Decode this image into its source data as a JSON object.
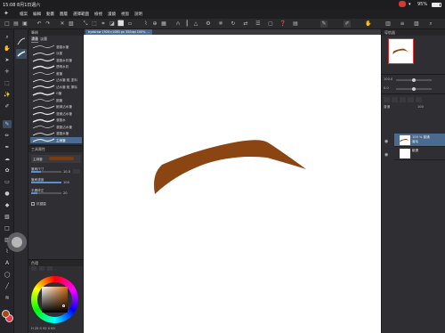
{
  "status": {
    "time": "15:08",
    "date": "8月1日週六",
    "battery": "95%"
  },
  "menu": {
    "items": [
      "檔案",
      "編輯",
      "動畫",
      "圖層",
      "選擇範圍",
      "檢視",
      "濾鏡",
      "視窗",
      "說明"
    ]
  },
  "document": {
    "tab_title": "eyebrow 1920×1080 px 350dpi 100% ..."
  },
  "brush_panel": {
    "title": "筆刷",
    "tabs": [
      "濃墨",
      "淡墨"
    ],
    "brushes": [
      {
        "label": "濃墨水筆"
      },
      {
        "label": "淡墨"
      },
      {
        "label": "濃墨水彩筆"
      },
      {
        "label": "透明水彩"
      },
      {
        "label": "畫筆"
      },
      {
        "label": "沾水筆 粗 塗料"
      },
      {
        "label": "沾水筆 粗 擦除"
      },
      {
        "label": "G筆"
      },
      {
        "label": "圓筆"
      },
      {
        "label": "飽滿沾水筆"
      },
      {
        "label": "漫畫沾水筆"
      },
      {
        "label": "濃墨水"
      },
      {
        "label": "濃墨沾水筆"
      },
      {
        "label": "濃墨水筆"
      },
      {
        "label": "主線筆"
      }
    ],
    "selected_index": 14
  },
  "tool_property": {
    "title": "工具屬性",
    "preview_label": "主線筆",
    "brush_size_label": "筆刷尺寸",
    "brush_size_value": "10.0",
    "brush_size_fraction": 0.32,
    "density_label": "筆刷濃度",
    "density_value": "100",
    "density_fraction": 1.0,
    "stabilize_label": "手震修正",
    "stabilize_value": "20",
    "stabilize_fraction": 0.2,
    "antialias_label": "抗鋸齒"
  },
  "color_panel": {
    "title": "色環",
    "footer": "H 25  S 92  V 65",
    "fg_color": "#a64812",
    "bg_color": "#ee3344"
  },
  "navigator": {
    "title": "導航器",
    "zoom_label": "100.0",
    "rotate_label": "0.0"
  },
  "layer_panel": {
    "title": "圖層",
    "layers": [
      {
        "name": "100 % 普通",
        "sub": "眉毛"
      },
      {
        "name": "100 % 普通",
        "sub": "紙張"
      }
    ],
    "blend_mode": "普通",
    "opacity": "100"
  },
  "eyebrow_color": "#8b4513",
  "accent": "#4a6a90"
}
